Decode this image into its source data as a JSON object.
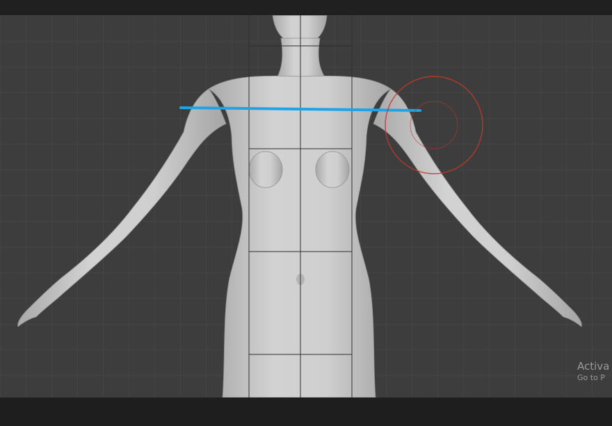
{
  "watermark": {
    "line1": "Activa",
    "line2": "Go to P"
  },
  "colors": {
    "background": "#3d3d3d",
    "grid": "#4a4a4a",
    "model": "#c9c9c9",
    "measure_line": "#1fa3e6",
    "brush_cursor": "#c0392b"
  },
  "icons": {
    "brush_cursor": "brush-cursor-icon"
  }
}
